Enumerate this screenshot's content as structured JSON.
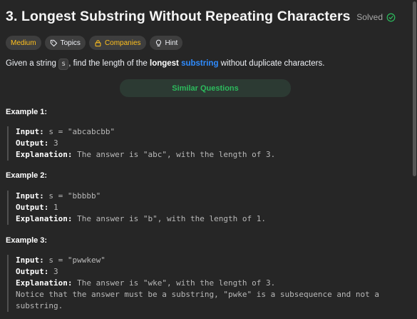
{
  "title": "3. Longest Substring Without Repeating Characters",
  "status": {
    "label": "Solved"
  },
  "tags": [
    {
      "label": "Medium"
    },
    {
      "label": "Topics"
    },
    {
      "label": "Companies"
    },
    {
      "label": "Hint"
    }
  ],
  "description": {
    "p1": "Given a string ",
    "code": "s",
    "p2": ", find the length of the ",
    "bold": "longest",
    "link": "substring",
    "p3": " without duplicate characters."
  },
  "similar_questions": "Similar Questions",
  "examples": [
    {
      "title": "Example 1:",
      "input_label": "Input:",
      "input": "s = \"abcabcbb\"",
      "output_label": "Output:",
      "output": "3",
      "explanation_label": "Explanation:",
      "explanation": "The answer is \"abc\", with the length of 3.",
      "extra": []
    },
    {
      "title": "Example 2:",
      "input_label": "Input:",
      "input": "s = \"bbbbb\"",
      "output_label": "Output:",
      "output": "1",
      "explanation_label": "Explanation:",
      "explanation": "The answer is \"b\", with the length of 1.",
      "extra": []
    },
    {
      "title": "Example 3:",
      "input_label": "Input:",
      "input": "s = \"pwwkew\"",
      "output_label": "Output:",
      "output": "3",
      "explanation_label": "Explanation:",
      "explanation": "The answer is \"wke\", with the length of 3.",
      "extra": [
        "Notice that the answer must be a substring, \"pwke\" is a subsequence and not a",
        "substring."
      ]
    }
  ],
  "colors": {
    "background": "#262626",
    "accent_green": "#2cbb5d",
    "medium_yellow": "#ffc01e",
    "link_blue": "#2f8cff"
  }
}
